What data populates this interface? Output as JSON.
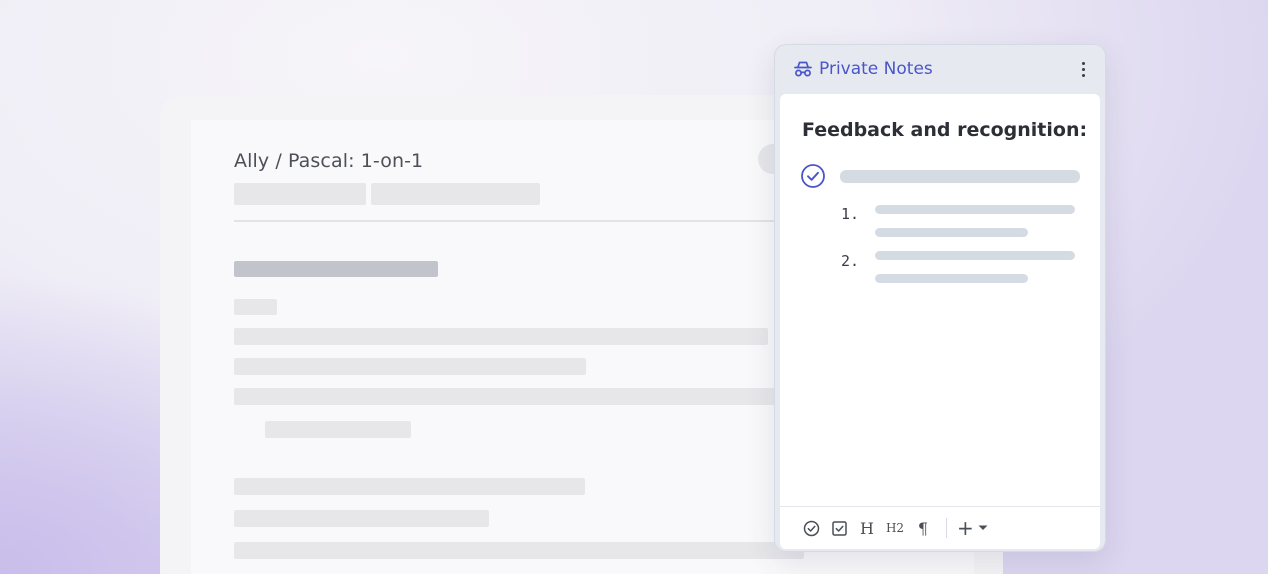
{
  "document": {
    "title": "Ally / Pascal: 1-on-1"
  },
  "notes_panel": {
    "title": "Private Notes",
    "header_icon": "spy-incognito-icon",
    "menu_icon": "kebab-menu-icon",
    "heading": "Feedback and recognition:",
    "list_markers": [
      "1.",
      "2."
    ],
    "toolbar": {
      "heading_label": "H",
      "h2_label": "H2",
      "paragraph_label": "¶",
      "add_label": "+"
    }
  },
  "colors": {
    "accent": "#4a55c9",
    "panel_bg": "#e6eaf0",
    "placeholder": "#d4dbe2"
  }
}
